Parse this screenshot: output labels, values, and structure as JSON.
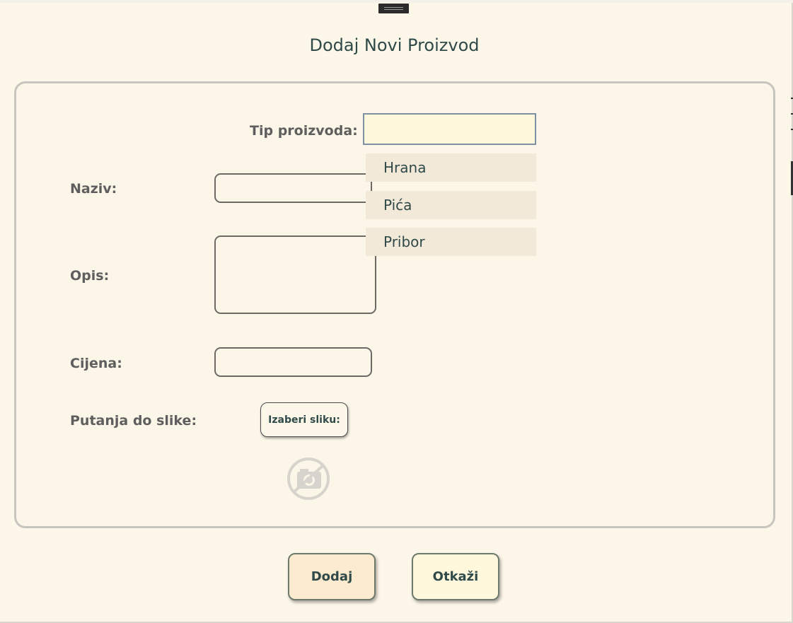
{
  "dialog": {
    "title": "Dodaj Novi Proizvod"
  },
  "form": {
    "type_label": "Tip proizvoda:",
    "type_value": "",
    "name_label": "Naziv:",
    "name_value": "",
    "description_label": "Opis:",
    "description_value": "",
    "price_label": "Cijena:",
    "price_value": "",
    "image_path_label": "Putanja do slike:",
    "choose_image_label": "Izaberi sliku:",
    "image_placeholder_icon": "no-camera-icon"
  },
  "type_dropdown": {
    "options": [
      "Hrana",
      "Pića",
      "Pribor"
    ]
  },
  "actions": {
    "add_label": "Dodaj",
    "cancel_label": "Otkaži"
  },
  "colors": {
    "background": "#fdf7ea",
    "title_text": "#2f4a48",
    "label_text": "#5e5e5e",
    "combo_fill": "#fff8dd",
    "dropdown_item": "#f3e9d8",
    "add_button": "#fdebd0",
    "cancel_button": "#fff8dd"
  }
}
